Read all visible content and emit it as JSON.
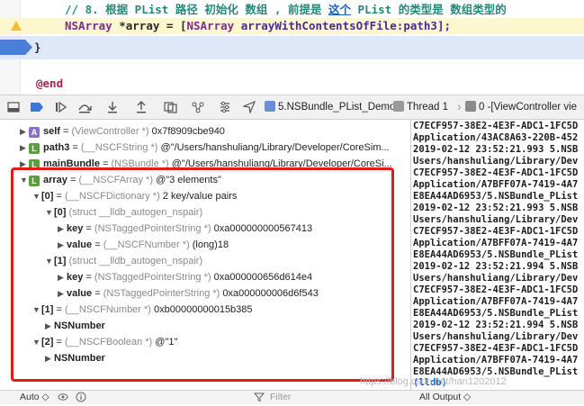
{
  "editor": {
    "comment_line": "// 8. 根据 PList 路径 初始化 数组 , 前提是 这个 PList 的类型是 数组类型的",
    "comment_prefix": "// 8. 根据 PList 路径 初始化 数组 , 前提是 ",
    "comment_highlight": "这个",
    "comment_suffix": " PList 的类型是 数组类型的",
    "array_line_type": "NSArray",
    "array_line_mid": " *array = [",
    "array_line_type2": "NSArray",
    "array_line_func": " arrayWithContentsOfFile:path3];",
    "brace": "}",
    "end": "@end"
  },
  "debug_bar": {
    "target": "5.NSBundle_PList_Demo",
    "thread": "Thread 1",
    "frame": "0 -[ViewController vie"
  },
  "variables": [
    {
      "name": "self",
      "type": "(ViewController *)",
      "value": "0x7f8909cbe940",
      "badge": "A"
    },
    {
      "name": "path3",
      "type": "(__NSCFString *)",
      "value": "@\"/Users/hanshuliang/Library/Developer/CoreSim...",
      "badge": "L"
    },
    {
      "name": "mainBundle",
      "type": "(NSBundle *)",
      "value": "@\"/Users/hanshuliang/Library/Developer/CoreSi...",
      "badge": "L"
    },
    {
      "name": "array",
      "type": "(__NSCFArray *)",
      "value": "@\"3 elements\"",
      "badge": "L"
    }
  ],
  "array_tree": {
    "item0": {
      "label": "[0]",
      "type": "(__NSCFDictionary *)",
      "value": "2 key/value pairs"
    },
    "pair0": {
      "label": "[0]",
      "type": "(struct __lldb_autogen_nspair)"
    },
    "pair0_key": {
      "label": "key",
      "type": "(NSTaggedPointerString *)",
      "value": "0xa000000000567413"
    },
    "pair0_value": {
      "label": "value",
      "type": "(__NSCFNumber *)",
      "value": "(long)18"
    },
    "pair1": {
      "label": "[1]",
      "type": "(struct __lldb_autogen_nspair)"
    },
    "pair1_key": {
      "label": "key",
      "type": "(NSTaggedPointerString *)",
      "value": "0xa000000656d614e4"
    },
    "pair1_value": {
      "label": "value",
      "type": "(NSTaggedPointerString *)",
      "value": "0xa000000006d6f543"
    },
    "item1": {
      "label": "[1]",
      "type": "(__NSCFNumber *)",
      "value": "0xb00000000015b385"
    },
    "item1_child": "NSNumber",
    "item2": {
      "label": "[2]",
      "type": "(__NSCFBoolean *)",
      "value": "@\"1\""
    },
    "item2_child": "NSNumber"
  },
  "console_lines": [
    "C7ECF957-38E2-4E3F-ADC1-1FC5D",
    "Application/43AC8A63-220B-452",
    "2019-02-12 23:52:21.993 5.NSB",
    "Users/hanshuliang/Library/Dev",
    "C7ECF957-38E2-4E3F-ADC1-1FC5D",
    "Application/A7BFF07A-7419-4A7",
    "E8EA44AD6953/5.NSBundle_PList",
    "2019-02-12 23:52:21.993 5.NSB",
    "Users/hanshuliang/Library/Dev",
    "C7ECF957-38E2-4E3F-ADC1-1FC5D",
    "Application/A7BFF07A-7419-4A7",
    "E8EA44AD6953/5.NSBundle_PList",
    "2019-02-12 23:52:21.994 5.NSB",
    "Users/hanshuliang/Library/Dev",
    "C7ECF957-38E2-4E3F-ADC1-1FC5D",
    "Application/A7BFF07A-7419-4A7",
    "E8EA44AD6953/5.NSBundle_PList",
    "2019-02-12 23:52:21.994 5.NSB",
    "Users/hanshuliang/Library/Dev",
    "C7ECF957-38E2-4E3F-ADC1-1FC5D",
    "Application/A7BFF07A-7419-4A7",
    "E8EA44AD6953/5.NSBundle_PList"
  ],
  "console_prompt": "(lldb)",
  "bottom_bar": {
    "auto": "Auto ◇",
    "filter_placeholder": "Filter",
    "all_output": "All Output ◇"
  },
  "watermark": "https://blog.csdn.net/han1202012"
}
